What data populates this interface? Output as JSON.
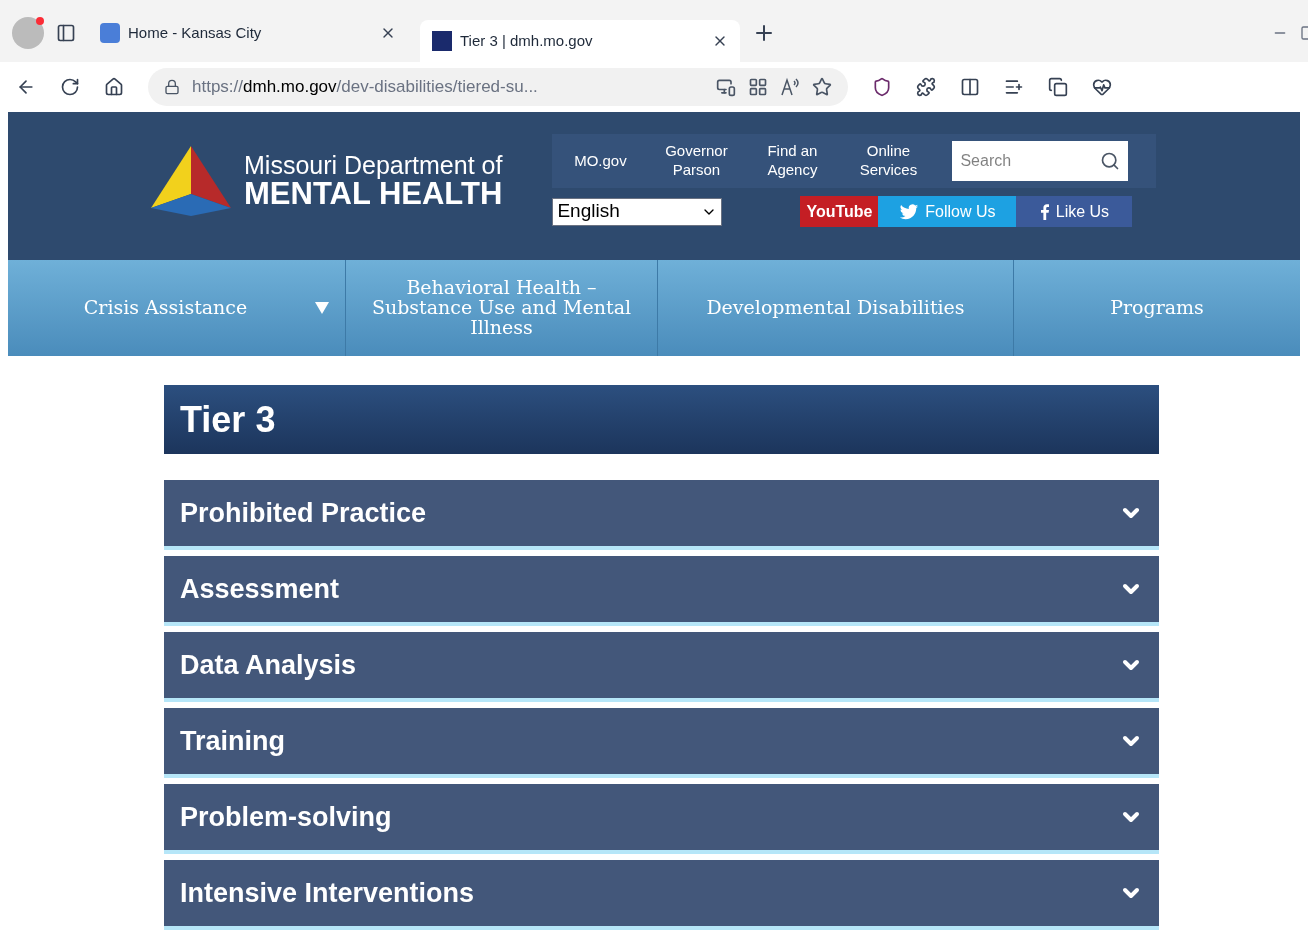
{
  "browser": {
    "tabs": [
      {
        "title": "Home - Kansas City",
        "selected": false
      },
      {
        "title": "Tier 3 | dmh.mo.gov",
        "selected": true
      }
    ],
    "address": {
      "prefix": "https://",
      "host": "dmh.mo.gov",
      "path": "/dev-disabilities/tiered-su..."
    }
  },
  "header": {
    "logo_line1": "Missouri Department of",
    "logo_line2": "MENTAL HEALTH",
    "links": [
      "MO.gov",
      "Governor Parson",
      "Find an Agency",
      "Online Services"
    ],
    "search": {
      "placeholder": "Search"
    },
    "language": "English",
    "social": [
      {
        "kind": "youtube",
        "label": "YouTube"
      },
      {
        "kind": "twitter",
        "label": "Follow Us"
      },
      {
        "kind": "facebook",
        "label": "Like Us"
      }
    ]
  },
  "nav": [
    {
      "label": "Crisis Assistance",
      "has_menu": true
    },
    {
      "label": "Behavioral Health – Substance Use and Mental Illness",
      "has_menu": false
    },
    {
      "label": "Developmental Disabilities",
      "has_menu": false
    },
    {
      "label": "Programs",
      "has_menu": false
    }
  ],
  "page_title": "Tier 3",
  "accordion": [
    {
      "title": "Prohibited Practice",
      "expanded": false
    },
    {
      "title": "Assessment",
      "expanded": false
    },
    {
      "title": "Data Analysis",
      "expanded": false
    },
    {
      "title": "Training",
      "expanded": false
    },
    {
      "title": "Problem-solving",
      "expanded": false
    },
    {
      "title": "Intensive Interventions",
      "expanded": false
    }
  ]
}
